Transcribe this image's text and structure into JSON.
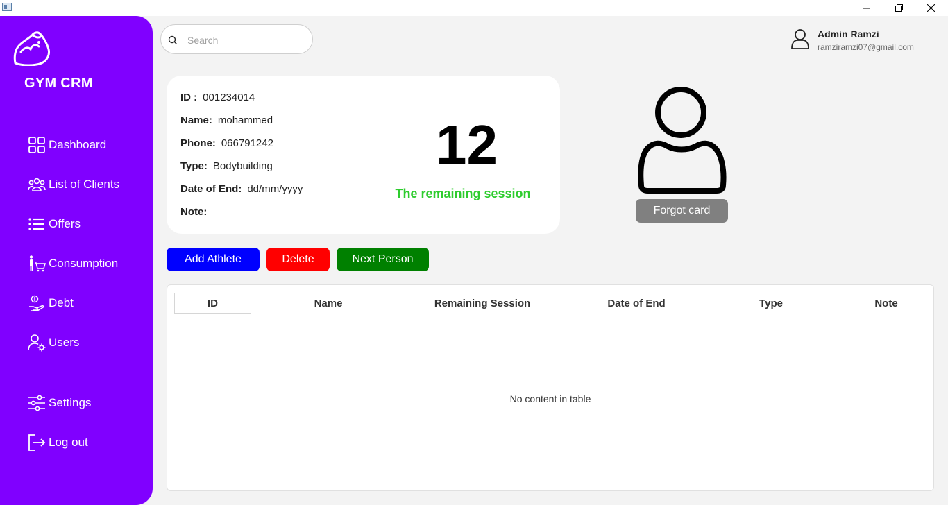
{
  "window": {
    "title": ""
  },
  "sidebar": {
    "brand": "GYM CRM",
    "items": [
      {
        "label": "Dashboard",
        "icon": "dashboard-icon"
      },
      {
        "label": "List of Clients",
        "icon": "clients-icon"
      },
      {
        "label": "Offers",
        "icon": "list-icon"
      },
      {
        "label": "Consumption",
        "icon": "shopping-cart-icon"
      },
      {
        "label": "Debt",
        "icon": "debt-icon"
      },
      {
        "label": "Users",
        "icon": "user-settings-icon"
      },
      {
        "label": "Settings",
        "icon": "sliders-icon"
      },
      {
        "label": "Log out",
        "icon": "logout-icon"
      }
    ]
  },
  "search": {
    "placeholder": "Search",
    "value": ""
  },
  "user": {
    "name": "Admin Ramzi",
    "email": "ramziramzi07@gmail.com"
  },
  "card": {
    "id_label": "ID :",
    "id_value": "001234014",
    "name_label": "Name:",
    "name_value": "mohammed",
    "phone_label": "Phone:",
    "phone_value": "066791242",
    "type_label": "Type:",
    "type_value": "Bodybuilding",
    "end_label": "Date of End:",
    "end_value": "dd/mm/yyyy",
    "note_label": "Note:",
    "note_value": "",
    "remaining_count": "12",
    "remaining_label": "The remaining session"
  },
  "profile": {
    "forgot_label": "Forgot card"
  },
  "actions": {
    "add_label": "Add Athlete",
    "delete_label": "Delete",
    "next_label": "Next Person"
  },
  "table": {
    "columns": [
      "ID",
      "Name",
      "Remaining Session",
      "Date of End",
      "Type",
      "Note"
    ],
    "rows": [],
    "empty_text": "No content in table"
  },
  "colors": {
    "sidebar": "#8000ff",
    "add": "#0000ff",
    "delete": "#ff0000",
    "next": "#008000",
    "forgot": "#808080",
    "remaining": "#2ecc2e"
  }
}
